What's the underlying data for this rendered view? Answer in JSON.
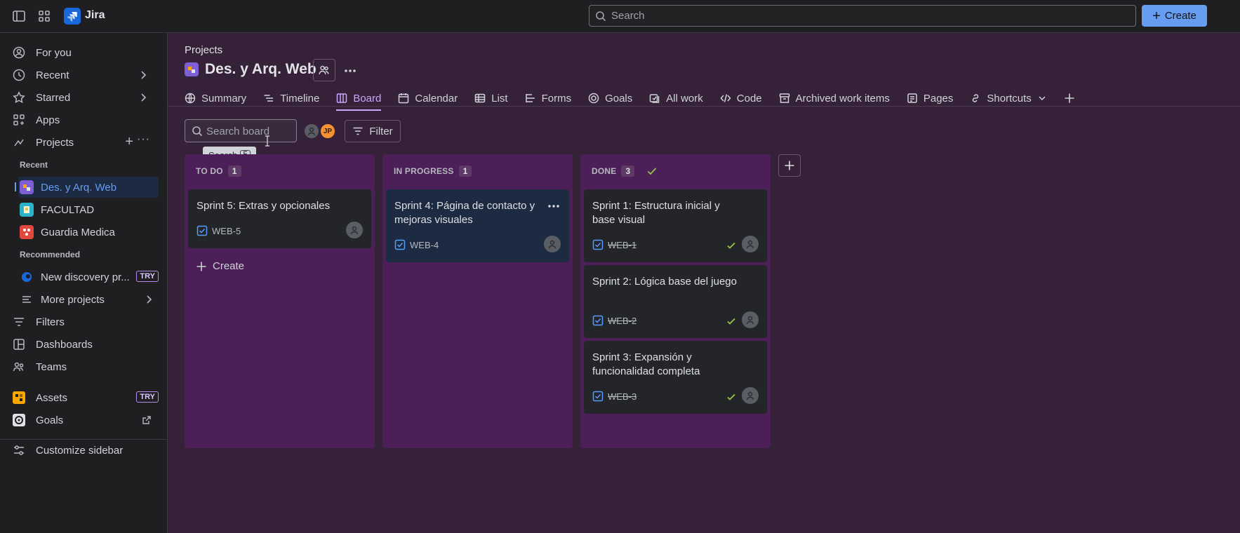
{
  "topbar": {
    "app_name": "Jira",
    "search_placeholder": "Search",
    "create_label": "Create"
  },
  "sidebar": {
    "for_you": "For you",
    "recent": "Recent",
    "starred": "Starred",
    "apps": "Apps",
    "projects": "Projects",
    "section_recent": "Recent",
    "recent_projects": [
      "Des. y Arq. Web",
      "FACULTAD",
      "Guardia Medica"
    ],
    "section_recommended": "Recommended",
    "discovery": "New discovery pr...",
    "try_badge": "TRY",
    "more_projects": "More projects",
    "filters": "Filters",
    "dashboards": "Dashboards",
    "teams": "Teams",
    "assets": "Assets",
    "goals": "Goals",
    "customize": "Customize sidebar"
  },
  "header": {
    "breadcrumb": "Projects",
    "title": "Des. y Arq. Web"
  },
  "tabs": [
    "Summary",
    "Timeline",
    "Board",
    "Calendar",
    "List",
    "Forms",
    "Goals",
    "All work",
    "Code",
    "Archived work items",
    "Pages",
    "Shortcuts"
  ],
  "toolbar": {
    "search_placeholder": "Search board",
    "tooltip_label": "Search",
    "tooltip_key": "F",
    "avatar_initials": "JP",
    "filter_label": "Filter"
  },
  "columns": [
    {
      "name": "TO DO",
      "count": "1",
      "cards": [
        {
          "title": "Sprint 5: Extras y opcionales",
          "key": "WEB-5"
        }
      ],
      "create_label": "Create"
    },
    {
      "name": "IN PROGRESS",
      "count": "1",
      "cards": [
        {
          "title": "Sprint 4: Página de contacto y mejoras visuales",
          "key": "WEB-4"
        }
      ]
    },
    {
      "name": "DONE",
      "count": "3",
      "cards": [
        {
          "title": "Sprint 1: Estructura inicial y base visual",
          "key": "WEB-1"
        },
        {
          "title": "Sprint 2: Lógica base del juego",
          "key": "WEB-2"
        },
        {
          "title": "Sprint 3: Expansión y funcionalidad completa",
          "key": "WEB-3"
        }
      ]
    }
  ],
  "colors": {
    "board_bg": "#352138",
    "column_bg": "#4d1f58",
    "accent": "#c5a7ff",
    "create_button": "#669df1",
    "done_check": "#94c748"
  }
}
